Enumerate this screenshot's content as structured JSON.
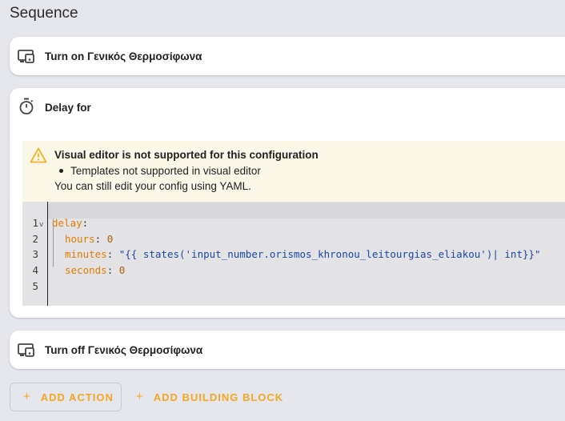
{
  "section": {
    "title": "Sequence"
  },
  "steps": [
    {
      "icon": "device-icon",
      "label": "Turn on Γενικός Θερμοσίφωνα"
    },
    {
      "icon": "timer-icon",
      "label": "Delay for"
    },
    {
      "icon": "device-icon",
      "label": "Turn off Γενικός Θερμοσίφωνα"
    }
  ],
  "warning": {
    "title": "Visual editor is not supported for this configuration",
    "item": "Templates not supported in visual editor",
    "note": "You can still edit your config using YAML."
  },
  "editor": {
    "line_numbers": [
      "1",
      "2",
      "3",
      "4",
      "5"
    ],
    "fold_marker": "v",
    "lines": [
      {
        "key": "delay",
        "sep": ":",
        "value": ""
      },
      {
        "key": "hours",
        "sep": ": ",
        "value": "0"
      },
      {
        "key": "minutes",
        "sep": ": ",
        "value": "\"{{ states('input_number.orismos_khronou_leitourgias_eliakou')| int}}\""
      },
      {
        "key": "seconds",
        "sep": ": ",
        "value": "0"
      },
      {
        "key": "",
        "sep": "",
        "value": ""
      }
    ]
  },
  "actions": {
    "add_action_label": "ADD ACTION",
    "add_block_label": "ADD BUILDING BLOCK",
    "plus": "+"
  },
  "colors": {
    "background": "#e5e7ec",
    "accent": "#f5a623",
    "warning_bg": "#fcf8e8",
    "yaml_key": "#e37a00",
    "yaml_number": "#b15c0a",
    "yaml_string": "#1b46a8"
  }
}
